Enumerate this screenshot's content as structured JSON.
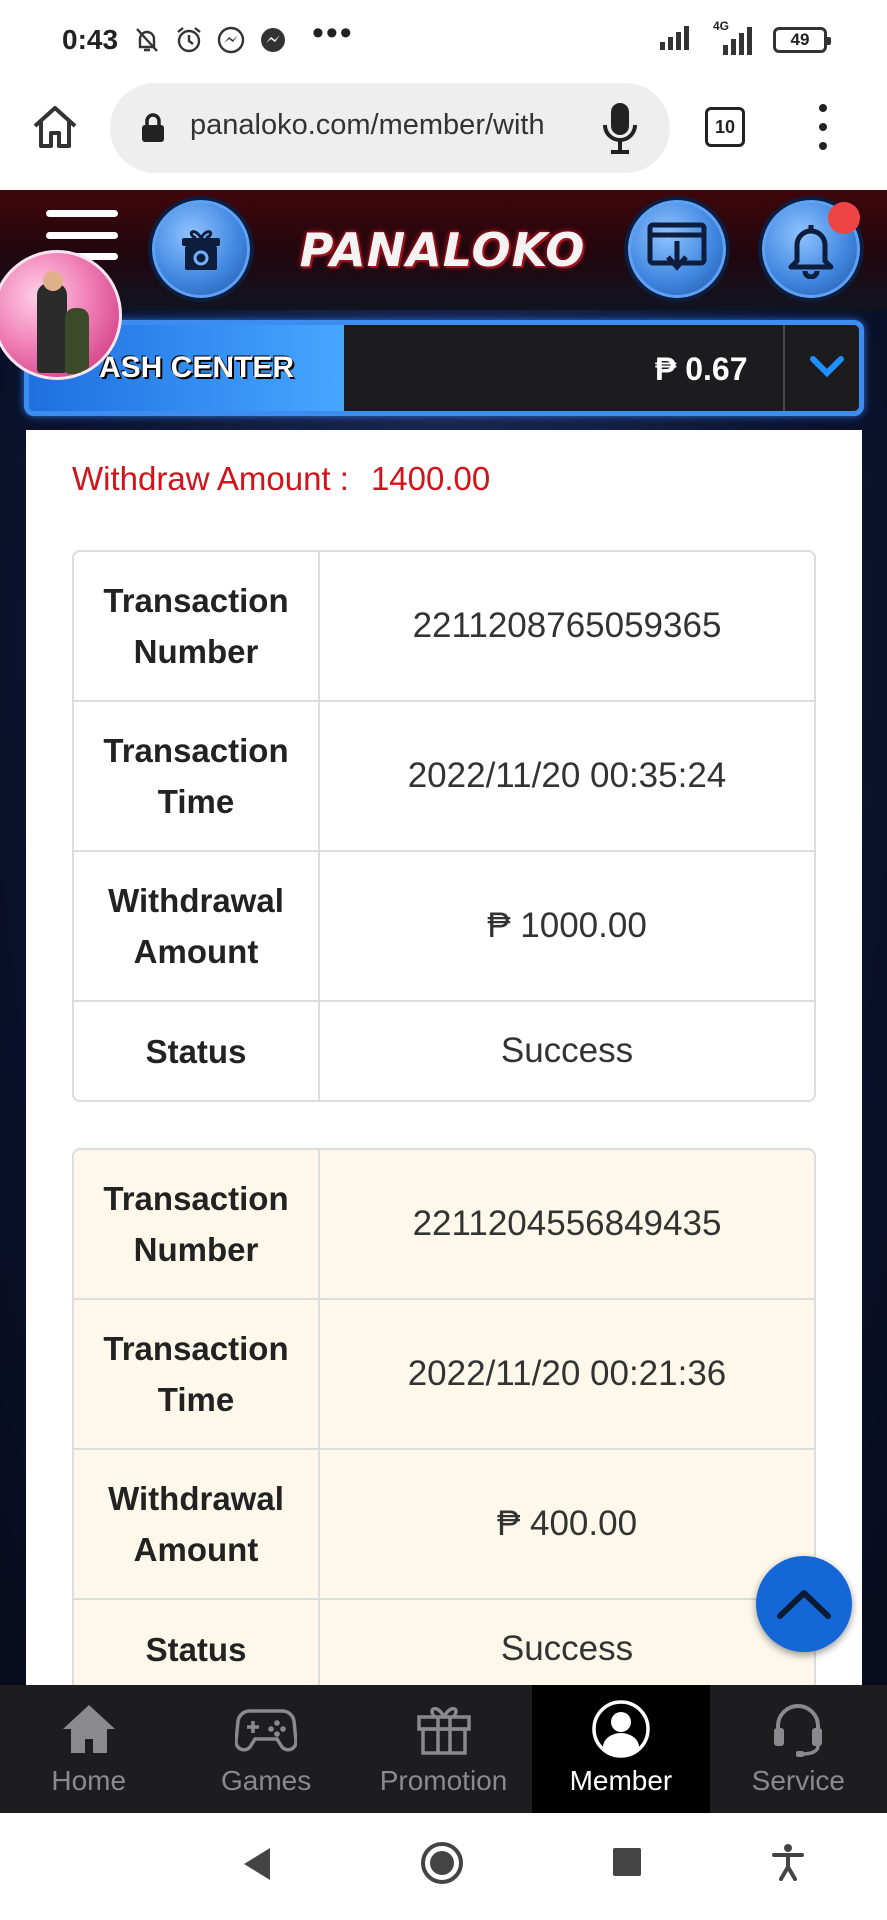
{
  "status_bar": {
    "time": "0:43",
    "more": "•••",
    "network": "4G",
    "battery": "49"
  },
  "browser": {
    "url": "panaloko.com/member/with",
    "tab_count": "10"
  },
  "site": {
    "logo_text": "PANALOKO",
    "cash_center": {
      "title": "ASH CENTER",
      "balance": "₱ 0.67"
    },
    "withdraw_amount": {
      "label": "Withdraw Amount :",
      "value": "1400.00"
    },
    "transactions": [
      {
        "number_label": "Transaction Number",
        "number": "2211208765059365",
        "time_label": "Transaction Time",
        "time": "2022/11/20 00:35:24",
        "amount_label": "Withdrawal Amount",
        "amount": "₱ 1000.00",
        "status_label": "Status",
        "status": "Success"
      },
      {
        "number_label": "Transaction Number",
        "number": "2211204556849435",
        "time_label": "Transaction Time",
        "time": "2022/11/20 00:21:36",
        "amount_label": "Withdrawal Amount",
        "amount": "₱ 400.00",
        "status_label": "Status",
        "status": "Success"
      }
    ],
    "bottom_nav": [
      {
        "label": "Home",
        "icon": "home-icon"
      },
      {
        "label": "Games",
        "icon": "gamepad-icon"
      },
      {
        "label": "Promotion",
        "icon": "gift-icon"
      },
      {
        "label": "Member",
        "icon": "member-icon",
        "active": true
      },
      {
        "label": "Service",
        "icon": "headset-icon"
      }
    ]
  },
  "colors": {
    "accent_blue": "#1567d8",
    "withdraw_red": "#d2131a",
    "header_red": "#40060b",
    "second_table_bg": "#fdf8ea"
  }
}
